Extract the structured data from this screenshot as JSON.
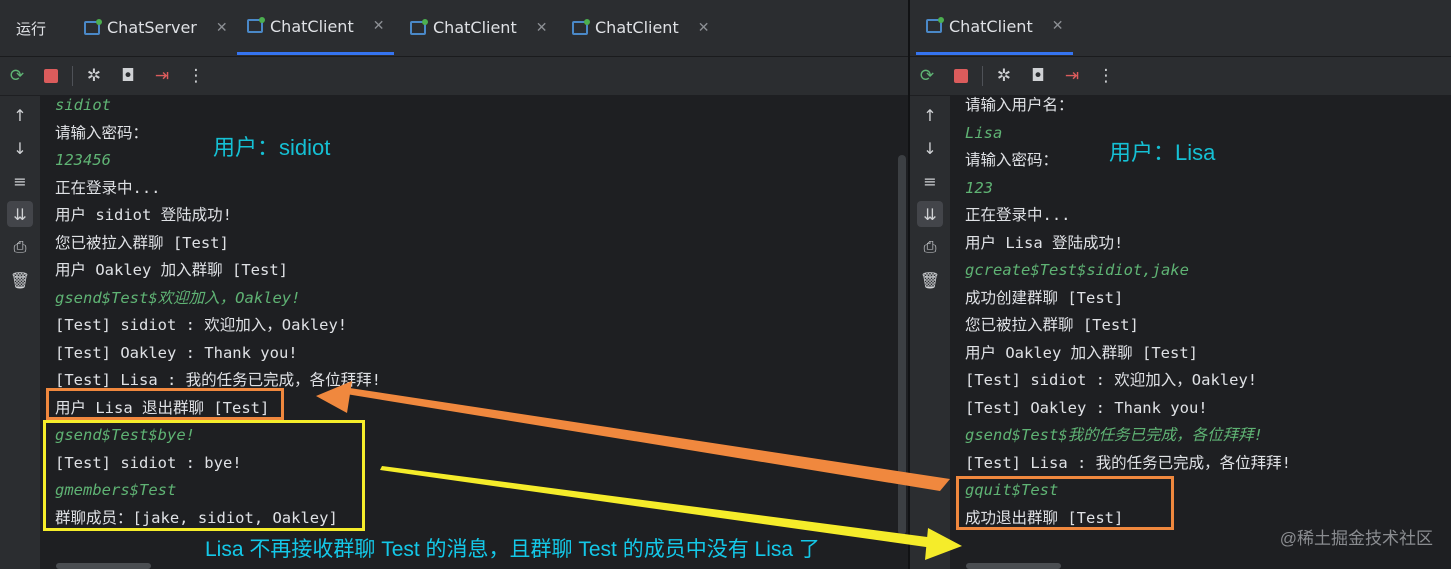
{
  "left": {
    "run_label": "运行",
    "tabs": [
      {
        "label": "ChatServer",
        "active": false
      },
      {
        "label": "ChatClient",
        "active": true
      },
      {
        "label": "ChatClient",
        "active": false
      },
      {
        "label": "ChatClient",
        "active": false
      }
    ],
    "user_label": "用户：sidiot",
    "lines": [
      {
        "text": "sidiot",
        "type": "input"
      },
      {
        "text": "请输入密码：",
        "type": "output"
      },
      {
        "text": "123456",
        "type": "input"
      },
      {
        "text": "正在登录中...",
        "type": "output"
      },
      {
        "text": "用户 sidiot 登陆成功!",
        "type": "output"
      },
      {
        "text": "您已被拉入群聊 [Test]",
        "type": "output"
      },
      {
        "text": "用户 Oakley 加入群聊 [Test]",
        "type": "output"
      },
      {
        "text": "gsend$Test$欢迎加入，Oakley!",
        "type": "input"
      },
      {
        "text": "[Test] sidiot : 欢迎加入，Oakley!",
        "type": "output"
      },
      {
        "text": "[Test] Oakley : Thank you!",
        "type": "output"
      },
      {
        "text": "[Test] Lisa : 我的任务已完成，各位拜拜!",
        "type": "output"
      },
      {
        "text": "用户 Lisa 退出群聊 [Test]",
        "type": "output"
      },
      {
        "text": "gsend$Test$bye!",
        "type": "input"
      },
      {
        "text": "[Test] sidiot : bye!",
        "type": "output"
      },
      {
        "text": "gmembers$Test",
        "type": "input"
      },
      {
        "text": "群聊成员：[jake, sidiot, Oakley]",
        "type": "output"
      }
    ]
  },
  "right": {
    "tabs": [
      {
        "label": "ChatClient",
        "active": true
      }
    ],
    "user_label": "用户：Lisa",
    "lines": [
      {
        "text": "请输入用户名：",
        "type": "output"
      },
      {
        "text": "Lisa",
        "type": "input"
      },
      {
        "text": "请输入密码：",
        "type": "output"
      },
      {
        "text": "123",
        "type": "input"
      },
      {
        "text": "正在登录中...",
        "type": "output"
      },
      {
        "text": "用户 Lisa 登陆成功!",
        "type": "output"
      },
      {
        "text": "gcreate$Test$sidiot,jake",
        "type": "input"
      },
      {
        "text": "成功创建群聊 [Test]",
        "type": "output"
      },
      {
        "text": "您已被拉入群聊 [Test]",
        "type": "output"
      },
      {
        "text": "用户 Oakley 加入群聊 [Test]",
        "type": "output"
      },
      {
        "text": "[Test] sidiot : 欢迎加入，Oakley!",
        "type": "output"
      },
      {
        "text": "[Test] Oakley : Thank you!",
        "type": "output"
      },
      {
        "text": "gsend$Test$我的任务已完成，各位拜拜!",
        "type": "input"
      },
      {
        "text": "[Test] Lisa : 我的任务已完成，各位拜拜!",
        "type": "output"
      },
      {
        "text": "gquit$Test",
        "type": "input"
      },
      {
        "text": "成功退出群聊 [Test]",
        "type": "output"
      }
    ]
  },
  "annotation": {
    "note": "Lisa 不再接收群聊 Test 的消息，且群聊 Test 的成员中没有 Lisa 了",
    "watermark": "@稀土掘金技术社区"
  },
  "toolbar_icons": [
    "rerun-icon",
    "stop-icon",
    "debug-icon",
    "screenshot-icon",
    "exit-icon",
    "more-icon"
  ],
  "sidebar_icons": [
    "up-arrow-icon",
    "down-arrow-icon",
    "soft-wrap-icon",
    "scroll-to-end-icon",
    "print-icon",
    "trash-icon"
  ],
  "colors": {
    "input_text": "#5fb374",
    "output_text": "#dfe1e5",
    "orange": "#f0883e",
    "yellow": "#f5ec2a",
    "label_cyan": "#15c0d4"
  }
}
